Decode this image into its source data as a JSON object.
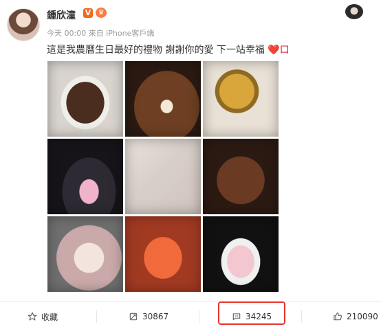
{
  "post": {
    "username": "鍾欣潼",
    "verified_badge": "V",
    "time": "今天 00:00",
    "source_prefix": "來自",
    "source": "iPhone客戶端",
    "text": "這是我農曆生日最好的禮物 謝謝你的愛 下一站幸福",
    "trailing_text": "❤️口"
  },
  "images": {
    "count": 9
  },
  "actions": {
    "favorite_label": "收藏",
    "repost_count": "30867",
    "comment_count": "34245",
    "like_count": "210090"
  },
  "icons": {
    "favorite": "star-icon",
    "repost": "repost-icon",
    "comment": "comment-icon",
    "like": "thumbs-up-icon"
  },
  "colors": {
    "highlight_border": "#e8352b",
    "badge": "#f06a1d",
    "text": "#333333",
    "muted": "#999999"
  }
}
